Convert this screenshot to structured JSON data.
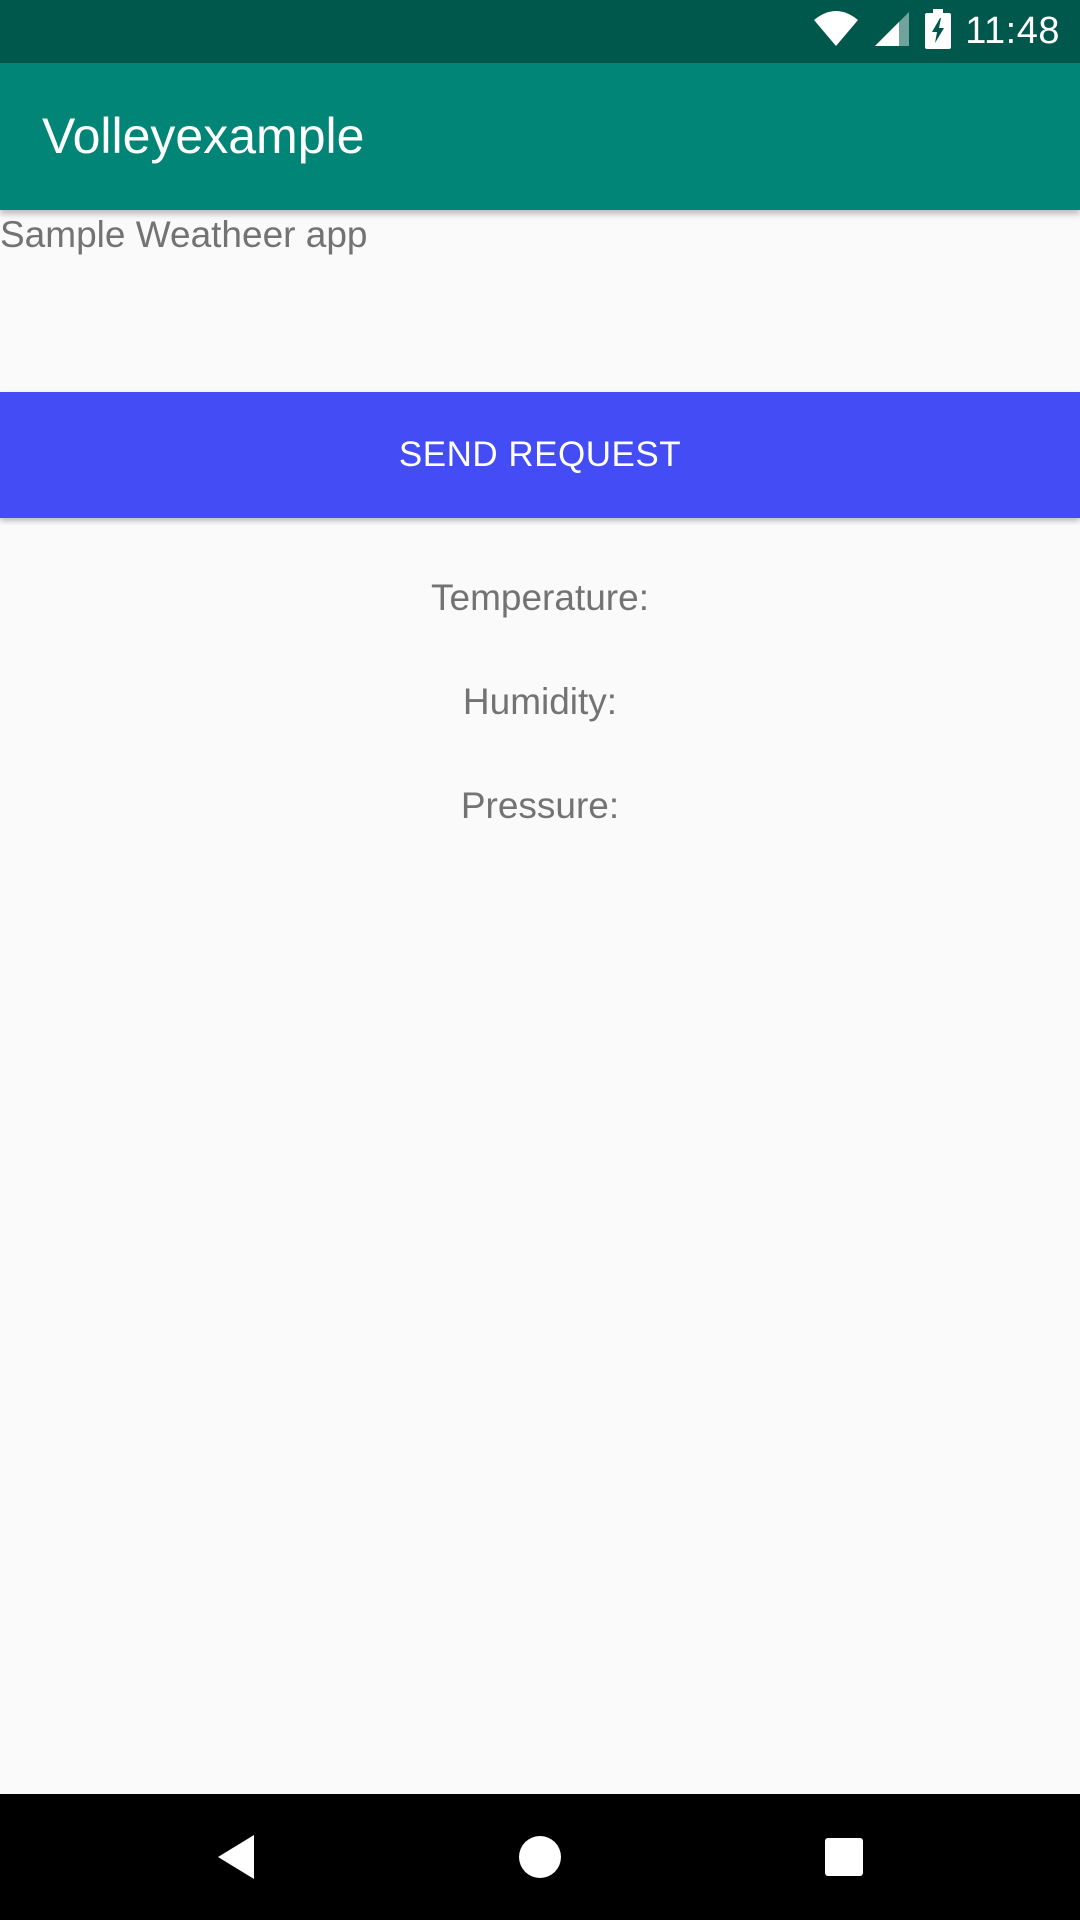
{
  "status_bar": {
    "time": "11:48",
    "icons": [
      "wifi-icon",
      "signal-icon",
      "battery-charging-icon"
    ],
    "color": "#00574b"
  },
  "app_bar": {
    "title": "Volleyexample",
    "color": "#008577"
  },
  "main": {
    "subtitle": "Sample Weatheer app",
    "send_button_label": "SEND REQUEST",
    "button_color": "#444cf6",
    "temperature_label": "Temperature:",
    "humidity_label": "Humidity:",
    "pressure_label": "Pressure:"
  },
  "nav_bar": {
    "buttons": [
      "back-icon",
      "home-icon",
      "recents-icon"
    ]
  }
}
